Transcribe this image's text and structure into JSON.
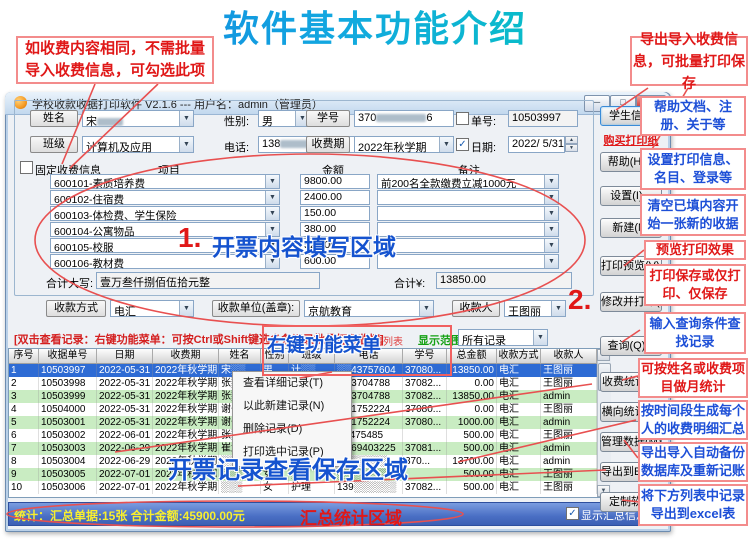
{
  "title": "软件基本功能介绍",
  "callouts": {
    "top_left": "如收费内容相同，不需批量导入收费信息，可勾选此项",
    "top_right": "导出导入收费信息，可批量打印保存",
    "zone1_num": "1.",
    "zone1": "开票内容填写区域",
    "zone2_num": "2.",
    "context_menu": "右键功能菜单",
    "records_zone": "开票记录查看保存区域",
    "summary_zone": "汇总统计区域",
    "right": [
      {
        "text": "帮助文档、注册、关于等",
        "color": "blue"
      },
      {
        "text": "设置打印信息、名目、登录等",
        "color": "blue"
      },
      {
        "text": "清空已填内容开始一张新的收据",
        "color": "blue"
      },
      {
        "text": "预览打印效果",
        "color": "red"
      },
      {
        "text": "打印保存或仅打印、仅保存",
        "color": "red"
      },
      {
        "text": "输入查询条件查找记录",
        "color": "blue"
      },
      {
        "text": "可按姓名或收费项目做月统计",
        "color": "red"
      },
      {
        "text": "按时间段生成每个人的收费明细汇总",
        "color": "blue"
      },
      {
        "text": "导出导入自动备份数据库及重新记账",
        "color": "blue"
      },
      {
        "text": "将下方列表中记录导出到excel表",
        "color": "blue"
      }
    ]
  },
  "window": {
    "title": "学校收款收据打印软件 V2.1.6 --- 用户名：admin（管理员）",
    "minimize": "─",
    "maximize": "□",
    "close": "✕"
  },
  "form": {
    "name_label": "姓名",
    "name_value": "宋",
    "sex_label": "性别:",
    "sex_value": "男",
    "sid_label": "学号",
    "sid_prefix": "370",
    "sid_suffix": "6",
    "order_label": "单号:",
    "order_value": "10503997",
    "class_label": "班级",
    "class_value": "计算机及应用",
    "phone_label": "电话:",
    "phone_prefix": "138",
    "term_label": "收费期",
    "term_value": "2022年秋学期",
    "date_label": "日期:",
    "date_value": "2022/ 5/31",
    "fixed_label": "固定收费信息"
  },
  "items": {
    "headers": {
      "project": "项目",
      "amount": "金额",
      "remark": "备注"
    },
    "rows": [
      {
        "project": "600101-素质培养费",
        "amount": "9800.00",
        "remark": "前200名全款缴费立减1000元"
      },
      {
        "project": "600102-住宿费",
        "amount": "2400.00",
        "remark": ""
      },
      {
        "project": "600103-体检费、学生保险",
        "amount": "150.00",
        "remark": ""
      },
      {
        "project": "600104-公寓物品",
        "amount": "380.00",
        "remark": ""
      },
      {
        "project": "600105-校服",
        "amount": "520.00",
        "remark": ""
      },
      {
        "project": "600106-教材费",
        "amount": "600.00",
        "remark": ""
      }
    ],
    "total_cn_label": "合计大写:",
    "total_cn": "壹万叁仟捌佰伍拾元整",
    "total_label": "合计¥:",
    "total": "13850.00"
  },
  "payment": {
    "method_label": "收款方式",
    "method": "电汇",
    "unit_label": "收款单位(盖章):",
    "unit": "京航教育",
    "payee_label": "收款人",
    "payee": "王图丽"
  },
  "records": {
    "hint": "[双击查看记录：右键功能菜单：可按Ctrl或Shift键选多条记录批量打印收据]",
    "detail_link": "显示详情列表",
    "scope_label": "显示范围:",
    "scope_value": "所有记录",
    "columns": [
      "序号",
      "收据单号",
      "日期",
      "收费期",
      "姓名",
      "性别",
      "班级",
      "电话",
      "学号",
      "总金额",
      "收款方式",
      "收款人"
    ],
    "rows": [
      {
        "state": "sel",
        "cells": [
          "1",
          "10503997",
          "2022-05-31",
          "2022年秋学期",
          "宋░░",
          "男",
          "计░░",
          "░░43757604",
          "37080...",
          "13850.00",
          "电汇",
          "王图丽"
        ]
      },
      {
        "state": "norm",
        "cells": [
          "2",
          "10503998",
          "2022-05-31",
          "2022年秋学期",
          "张░░",
          "",
          "",
          "░░3704788",
          "37082...",
          "0.00",
          "电汇",
          "王图丽"
        ]
      },
      {
        "state": "alt",
        "cells": [
          "3",
          "10503999",
          "2022-05-31",
          "2022年秋学期",
          "张░░",
          "",
          "",
          "░░3704788",
          "37082...",
          "13850.00",
          "电汇",
          "admin"
        ]
      },
      {
        "state": "norm",
        "cells": [
          "4",
          "10504000",
          "2022-05-31",
          "2022年秋学期",
          "谢子░",
          "",
          "",
          "░░1752224",
          "37080...",
          "0.00",
          "电汇",
          "王图丽"
        ]
      },
      {
        "state": "alt",
        "cells": [
          "5",
          "10503001",
          "2022-05-31",
          "2022年秋学期",
          "谢子░",
          "",
          "",
          "░░1752224",
          "37080...",
          "1000.00",
          "电汇",
          "admin"
        ]
      },
      {
        "state": "norm",
        "cells": [
          "6",
          "10503002",
          "2022-06-01",
          "2022年秋学期",
          "张░░",
          "",
          "",
          "░5475485",
          "",
          "500.00",
          "电汇",
          "王图丽"
        ]
      },
      {
        "state": "alt",
        "cells": [
          "7",
          "10503003",
          "2022-06-29",
          "2022年秋学期",
          "崔淑░",
          "女",
          "计算机░",
          "░░69403225",
          "37081...",
          "500.00",
          "电汇",
          "admin"
        ]
      },
      {
        "state": "norm",
        "cells": [
          "8",
          "10503004",
          "2022-06-29",
          "2022年秋学期",
          "░░░",
          "",
          "░░",
          "░░░░░░░",
          "370...",
          "13700.00",
          "电汇",
          "admin"
        ]
      },
      {
        "state": "alt",
        "cells": [
          "9",
          "10503005",
          "2022-07-01",
          "2022年秋学期",
          "░░░",
          "女",
          "░░",
          "░░░░░░░",
          "",
          "500.00",
          "电汇",
          "王图丽"
        ]
      },
      {
        "state": "norm",
        "cells": [
          "10",
          "10503006",
          "2022-07-01",
          "2022年秋学期",
          "░░░",
          "女",
          "护理",
          "139░░░░░░",
          "37082...",
          "500.00",
          "电汇",
          "王图丽"
        ]
      }
    ],
    "menu": [
      "查看详细记录(T)",
      "以此新建记录(N)",
      "删除记录(D)",
      "打印选中记录(P)"
    ]
  },
  "side_buttons": [
    "学生信息",
    "购买打印纸",
    "帮助(H)...",
    "设置(I)...",
    "新建(N)",
    "打印预览(V)...",
    "修改并打印(B)",
    "查询(Q)...",
    "收费统计(T)",
    "横向统计(X)",
    "管理数据(M)...",
    "导出到EXCEL",
    "定制软件"
  ],
  "status": {
    "summary": "统计：汇总单据:15张  合计金额:45900.00元",
    "show_label": "显示汇总信息"
  }
}
